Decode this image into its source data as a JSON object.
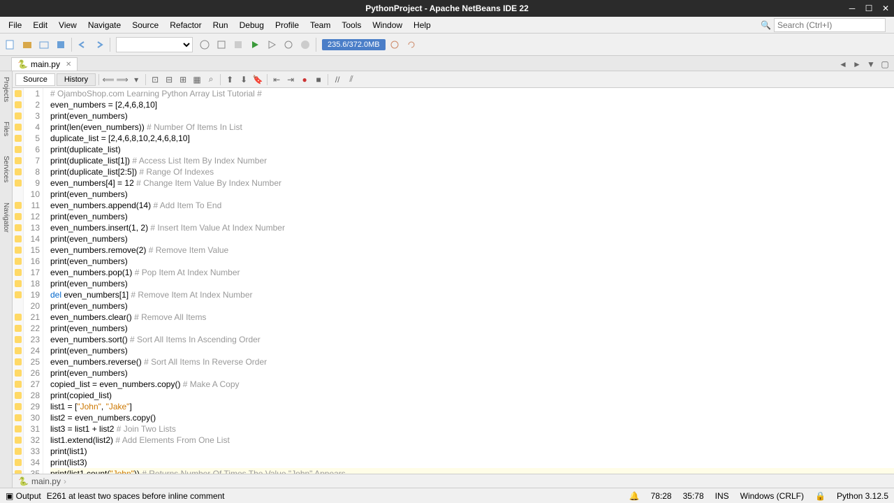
{
  "titlebar": {
    "text": "PythonProject - Apache NetBeans IDE 22"
  },
  "menubar": {
    "items": [
      "File",
      "Edit",
      "View",
      "Navigate",
      "Source",
      "Refactor",
      "Run",
      "Debug",
      "Profile",
      "Team",
      "Tools",
      "Window",
      "Help"
    ]
  },
  "search": {
    "placeholder": "Search (Ctrl+I)"
  },
  "memory": {
    "text": "235.6/372.0MB"
  },
  "fileTab": {
    "name": "main.py"
  },
  "editorTabs": {
    "source": "Source",
    "history": "History"
  },
  "leftRail": {
    "items": [
      "Projects",
      "Files",
      "Services",
      "Navigator"
    ]
  },
  "lines": [
    {
      "n": 1,
      "mark": true,
      "code": [
        {
          "t": "# OjamboShop.com Learning Python Array List Tutorial #",
          "c": "c-comment"
        }
      ]
    },
    {
      "n": 2,
      "mark": true,
      "code": [
        {
          "t": "even_numbers = [2,4,6,8,10]"
        }
      ]
    },
    {
      "n": 3,
      "mark": true,
      "code": [
        {
          "t": "print(even_numbers)"
        }
      ]
    },
    {
      "n": 4,
      "mark": true,
      "code": [
        {
          "t": "print(len(even_numbers)) "
        },
        {
          "t": "# Number Of Items In List",
          "c": "c-comment"
        }
      ]
    },
    {
      "n": 5,
      "mark": true,
      "code": [
        {
          "t": "duplicate_list = [2,4,6,8,10,2,4,6,8,10]"
        }
      ]
    },
    {
      "n": 6,
      "mark": true,
      "code": [
        {
          "t": "print(duplicate_list)"
        }
      ]
    },
    {
      "n": 7,
      "mark": true,
      "code": [
        {
          "t": "print(duplicate_list[1]) "
        },
        {
          "t": "# Access List Item By Index Number",
          "c": "c-comment"
        }
      ]
    },
    {
      "n": 8,
      "mark": true,
      "code": [
        {
          "t": "print(duplicate_list[2:5]) "
        },
        {
          "t": "# Range Of Indexes",
          "c": "c-comment"
        }
      ]
    },
    {
      "n": 9,
      "mark": true,
      "code": [
        {
          "t": "even_numbers[4] = 12 "
        },
        {
          "t": "# Change Item Value By Index Number",
          "c": "c-comment"
        }
      ]
    },
    {
      "n": 10,
      "mark": false,
      "code": [
        {
          "t": "print(even_numbers)"
        }
      ]
    },
    {
      "n": 11,
      "mark": true,
      "code": [
        {
          "t": "even_numbers.append(14) "
        },
        {
          "t": "# Add Item To End",
          "c": "c-comment"
        }
      ]
    },
    {
      "n": 12,
      "mark": true,
      "code": [
        {
          "t": "print(even_numbers)"
        }
      ]
    },
    {
      "n": 13,
      "mark": true,
      "code": [
        {
          "t": "even_numbers.insert(1, 2) "
        },
        {
          "t": "# Insert Item Value At Index Number",
          "c": "c-comment"
        }
      ]
    },
    {
      "n": 14,
      "mark": true,
      "code": [
        {
          "t": "print(even_numbers)"
        }
      ]
    },
    {
      "n": 15,
      "mark": true,
      "code": [
        {
          "t": "even_numbers.remove(2) "
        },
        {
          "t": "# Remove Item Value",
          "c": "c-comment"
        }
      ]
    },
    {
      "n": 16,
      "mark": true,
      "code": [
        {
          "t": "print(even_numbers)"
        }
      ]
    },
    {
      "n": 17,
      "mark": true,
      "code": [
        {
          "t": "even_numbers.pop(1) "
        },
        {
          "t": "# Pop Item At Index Number",
          "c": "c-comment"
        }
      ]
    },
    {
      "n": 18,
      "mark": true,
      "code": [
        {
          "t": "print(even_numbers)"
        }
      ]
    },
    {
      "n": 19,
      "mark": true,
      "code": [
        {
          "t": "del",
          "c": "c-keyword"
        },
        {
          "t": " even_numbers[1] "
        },
        {
          "t": "# Remove Item At Index Number",
          "c": "c-comment"
        }
      ]
    },
    {
      "n": 20,
      "mark": false,
      "code": [
        {
          "t": "print(even_numbers)"
        }
      ]
    },
    {
      "n": 21,
      "mark": true,
      "code": [
        {
          "t": "even_numbers.clear() "
        },
        {
          "t": "# Remove All Items",
          "c": "c-comment"
        }
      ]
    },
    {
      "n": 22,
      "mark": true,
      "code": [
        {
          "t": "print(even_numbers)"
        }
      ]
    },
    {
      "n": 23,
      "mark": true,
      "code": [
        {
          "t": "even_numbers.sort() "
        },
        {
          "t": "# Sort All Items In Ascending Order",
          "c": "c-comment"
        }
      ]
    },
    {
      "n": 24,
      "mark": true,
      "code": [
        {
          "t": "print(even_numbers)"
        }
      ]
    },
    {
      "n": 25,
      "mark": true,
      "code": [
        {
          "t": "even_numbers.reverse() "
        },
        {
          "t": "# Sort All Items In Reverse Order",
          "c": "c-comment"
        }
      ]
    },
    {
      "n": 26,
      "mark": true,
      "code": [
        {
          "t": "print(even_numbers)"
        }
      ]
    },
    {
      "n": 27,
      "mark": true,
      "code": [
        {
          "t": "copied_list = even_numbers.copy() "
        },
        {
          "t": "# Make A Copy",
          "c": "c-comment"
        }
      ]
    },
    {
      "n": 28,
      "mark": true,
      "code": [
        {
          "t": "print(copied_list)"
        }
      ]
    },
    {
      "n": 29,
      "mark": true,
      "code": [
        {
          "t": "list1 = ["
        },
        {
          "t": "\"John\"",
          "c": "c-string"
        },
        {
          "t": ", "
        },
        {
          "t": "\"Jake\"",
          "c": "c-string"
        },
        {
          "t": "]"
        }
      ]
    },
    {
      "n": 30,
      "mark": true,
      "code": [
        {
          "t": "list2 = even_numbers.copy()"
        }
      ]
    },
    {
      "n": 31,
      "mark": true,
      "code": [
        {
          "t": "list3 = list1 + list2 "
        },
        {
          "t": "# Join Two Lists",
          "c": "c-comment"
        }
      ]
    },
    {
      "n": 32,
      "mark": true,
      "code": [
        {
          "t": "list1.extend(list2) "
        },
        {
          "t": "# Add Elements From One List",
          "c": "c-comment"
        }
      ]
    },
    {
      "n": 33,
      "mark": true,
      "code": [
        {
          "t": "print(list1)"
        }
      ]
    },
    {
      "n": 34,
      "mark": true,
      "code": [
        {
          "t": "print(list3)"
        }
      ]
    },
    {
      "n": 35,
      "mark": true,
      "cursor": true,
      "code": [
        {
          "t": "print(list1.count("
        },
        {
          "t": "\"John\"",
          "c": "c-string"
        },
        {
          "t": ")) "
        },
        {
          "t": "# Returns Number Of Times The Value \"John\" Appears",
          "c": "c-comment"
        }
      ]
    }
  ],
  "breadcrumb": {
    "items": [
      "main.py"
    ]
  },
  "status": {
    "output": "Output",
    "lint": "E261 at least two spaces before inline comment",
    "time": "78:28",
    "pos": "35:78",
    "ins": "INS",
    "enc": "Windows (CRLF)",
    "py": "Python 3.12.5"
  },
  "icons": {
    "file": "#6aa0d8",
    "folder": "#d8a84a",
    "save": "#6aa0d8",
    "undo": "#6aa0d8",
    "redo": "#6aa0d8",
    "globe": "#888",
    "build": "#888",
    "clean": "#888",
    "run": "#3a9a3a",
    "debug": "#888",
    "profile": "#888",
    "stop": "#888"
  }
}
